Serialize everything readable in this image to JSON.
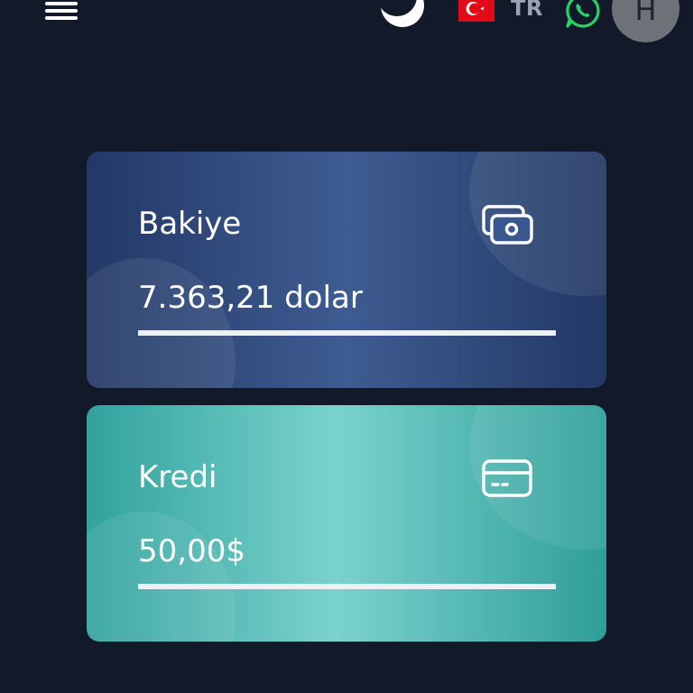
{
  "header": {
    "menu_icon": "hamburger-menu-icon",
    "theme_icon": "moon-icon",
    "language": {
      "flag": "turkey-flag",
      "code": "TR"
    },
    "whatsapp_icon": "whatsapp-icon",
    "avatar_initial": "H"
  },
  "cards": [
    {
      "title": "Bakiye",
      "value": "7.363,21 dolar",
      "icon": "money-icon",
      "progress": 1.0
    },
    {
      "title": "Kredi",
      "value": "50,00$",
      "icon": "credit-card-icon",
      "progress": 1.0
    }
  ],
  "colors": {
    "background": "#121a2a",
    "balance_card": "#3e5c91",
    "credit_card": "#7ad2cd",
    "whatsapp": "#25d366",
    "flag_red": "#e30a17"
  }
}
